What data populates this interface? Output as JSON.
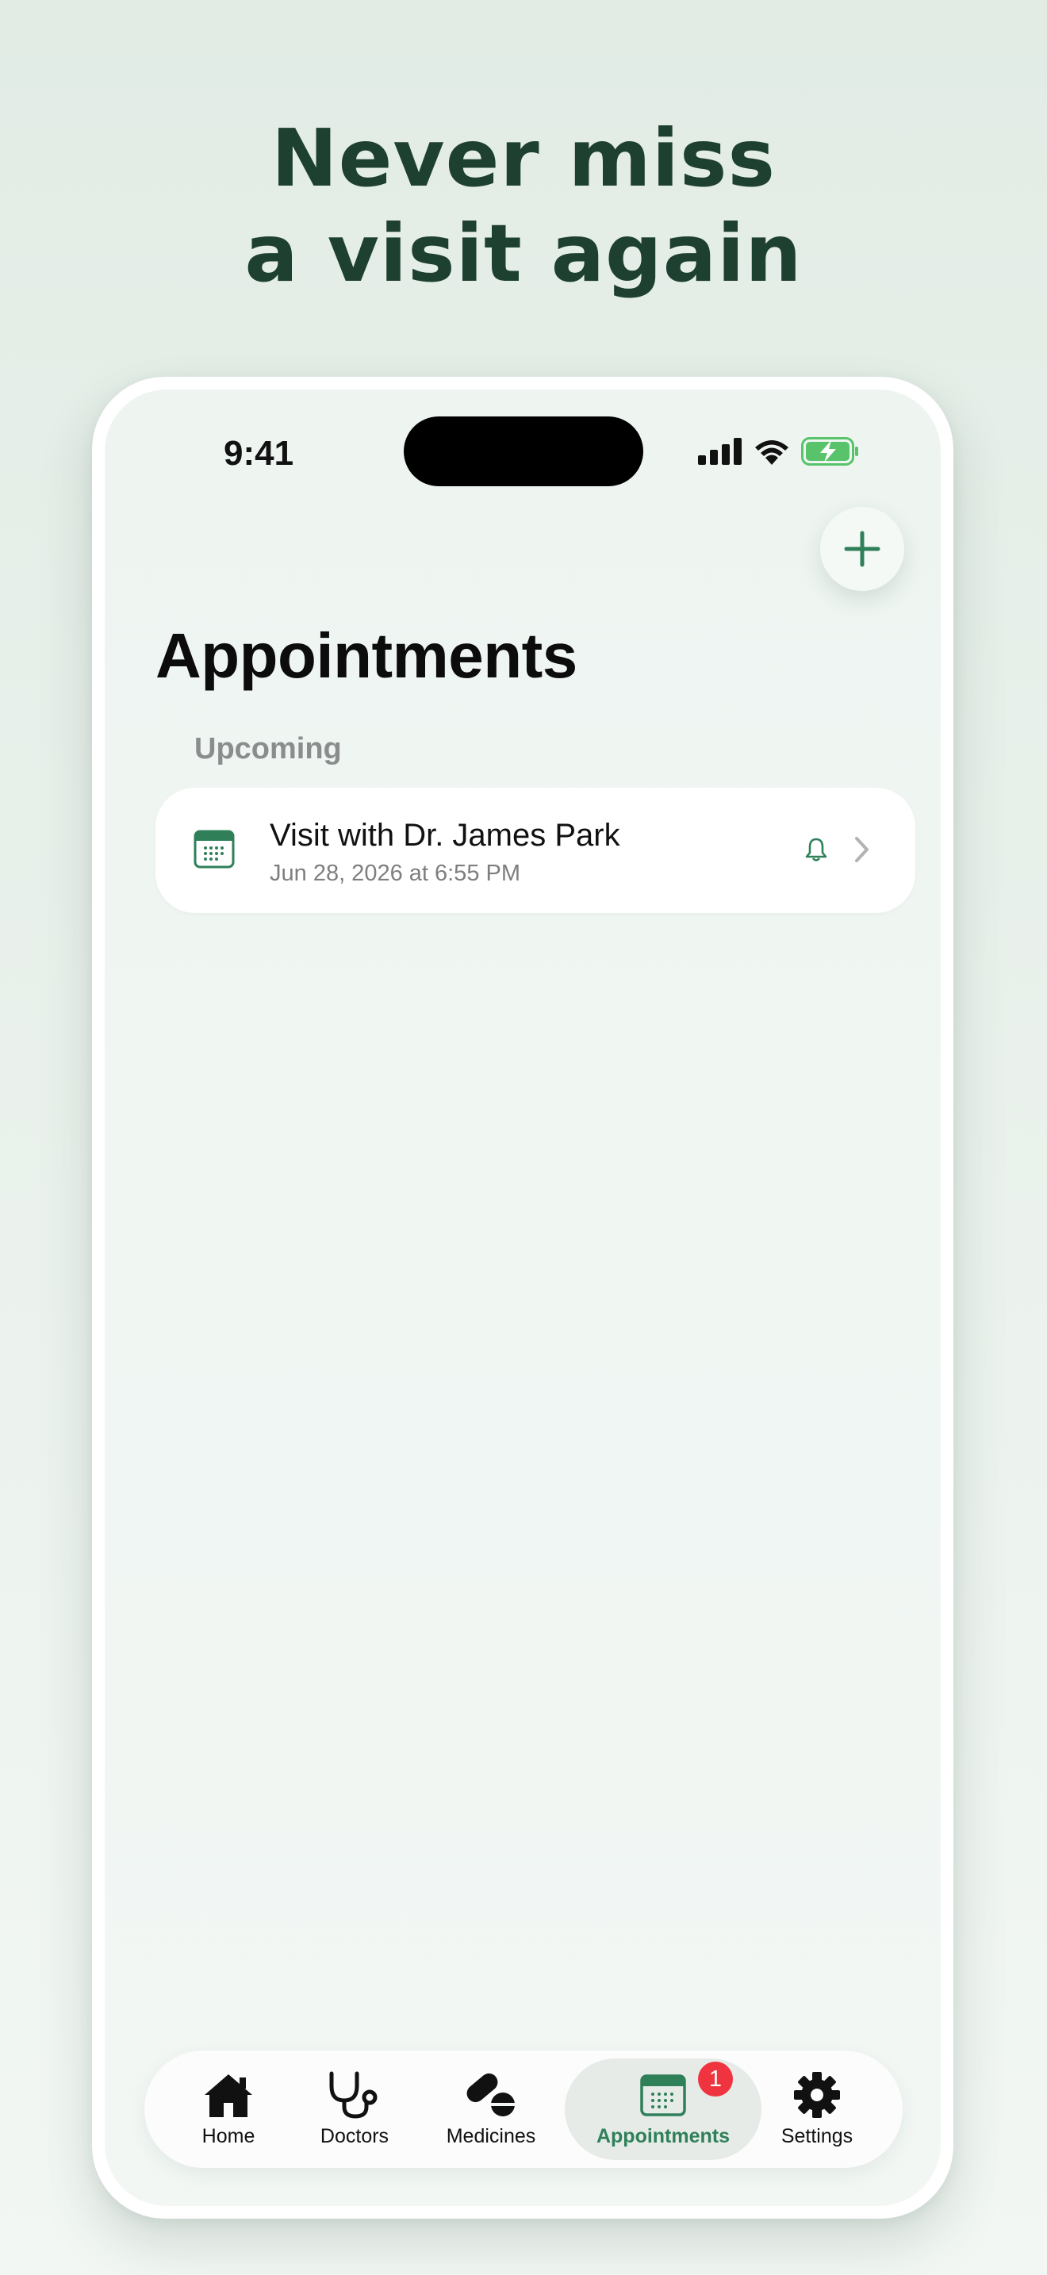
{
  "headline": {
    "line1": "Never miss",
    "line2": "a visit again"
  },
  "status_bar": {
    "time": "9:41",
    "icons": [
      "signal-icon",
      "wifi-icon",
      "battery-charging-icon"
    ]
  },
  "toolbar": {
    "add_icon": "plus-icon"
  },
  "page": {
    "title": "Appointments",
    "section_label": "Upcoming"
  },
  "appointments": [
    {
      "title": "Visit with Dr. James Park",
      "datetime": "Jun 28, 2026 at 6:55 PM",
      "icon": "calendar-icon",
      "reminder_icon": "bell-icon"
    }
  ],
  "tabbar": {
    "items": [
      {
        "label": "Home",
        "icon": "house-icon"
      },
      {
        "label": "Doctors",
        "icon": "stethoscope-icon"
      },
      {
        "label": "Medicines",
        "icon": "pills-icon"
      },
      {
        "label": "Appointments",
        "icon": "calendar-icon",
        "badge": "1",
        "active": true
      },
      {
        "label": "Settings",
        "icon": "gear-icon"
      }
    ]
  },
  "colors": {
    "accent": "#2f8059",
    "headline": "#1e4030",
    "badge": "#f0343f"
  }
}
